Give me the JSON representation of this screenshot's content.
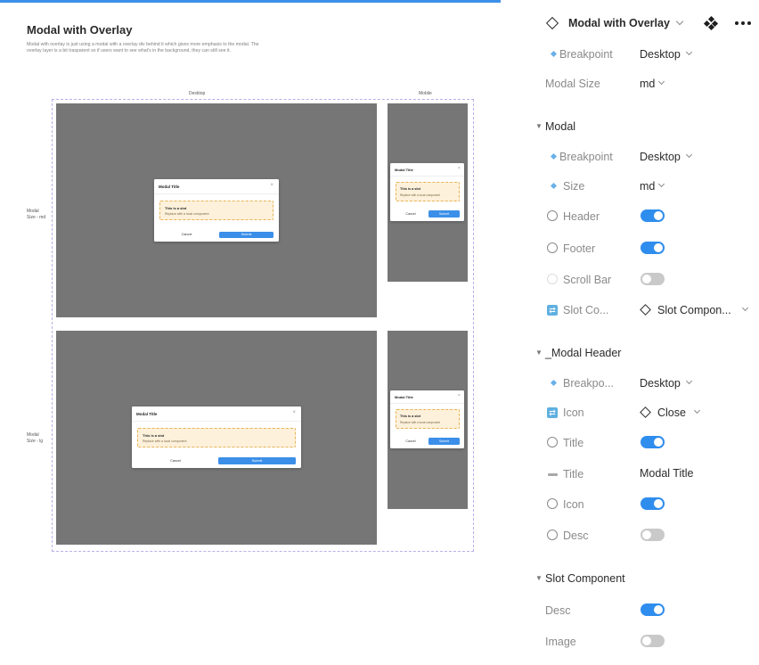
{
  "canvas": {
    "title": "Modal with Overlay",
    "description": "Modal with overlay is just using a modal with a overlay div behind it which gives more emphasis to the modal. The overlay layer is a bit trasparent so if users want to see what's in the background, they can still see it.",
    "col_labels": [
      "Desktop",
      "Mobile"
    ],
    "row_labels": [
      "Modal Size - md",
      "Modal Size - lg"
    ],
    "modal": {
      "title": "Modal Title",
      "close_glyph": "×",
      "slot_title": "This is a slot",
      "slot_desc": "Replace with a local component",
      "cancel": "Cancel",
      "submit": "Submit"
    },
    "colors": {
      "overlay": "#767676",
      "primary": "#3b8fe8",
      "slot_bg": "#fdf1db",
      "slot_border": "#e8b355",
      "frame_border": "#b9b0e8"
    }
  },
  "panel": {
    "component": {
      "name": "Modal with Overlay",
      "icon": "diamond-outline-icon"
    },
    "root": [
      {
        "label": "Breakpoint",
        "value": "Desktop",
        "icon": "variant-diamond-icon"
      },
      {
        "label": "Modal Size",
        "value": "md"
      }
    ],
    "modal_section": {
      "title": "Modal",
      "breakpoint": {
        "label": "Breakpoint",
        "value": "Desktop"
      },
      "size": {
        "label": "Size",
        "value": "md"
      },
      "header": {
        "label": "Header",
        "on": true
      },
      "footer": {
        "label": "Footer",
        "on": true
      },
      "scrollbar": {
        "label": "Scroll Bar",
        "on": false
      },
      "slot": {
        "label": "Slot Co...",
        "value": "Slot Compon..."
      }
    },
    "modal_header_section": {
      "title": "_Modal Header",
      "breakpoint": {
        "label": "Breakpo...",
        "value": "Desktop"
      },
      "icon_swap": {
        "label": "Icon",
        "value": "Close"
      },
      "title_toggle": {
        "label": "Title",
        "on": true
      },
      "title_text": {
        "label": "Title",
        "value": "Modal Title"
      },
      "icon_toggle": {
        "label": "Icon",
        "on": true
      },
      "desc_toggle": {
        "label": "Desc",
        "on": false
      }
    },
    "slot_section": {
      "title": "Slot Component",
      "desc": {
        "label": "Desc",
        "on": true
      },
      "image": {
        "label": "Image",
        "on": false
      }
    },
    "colors": {
      "toggle_on": "#2f8ded",
      "toggle_off": "#c9c9c9",
      "variant_icon": "#6ab0e8"
    }
  }
}
